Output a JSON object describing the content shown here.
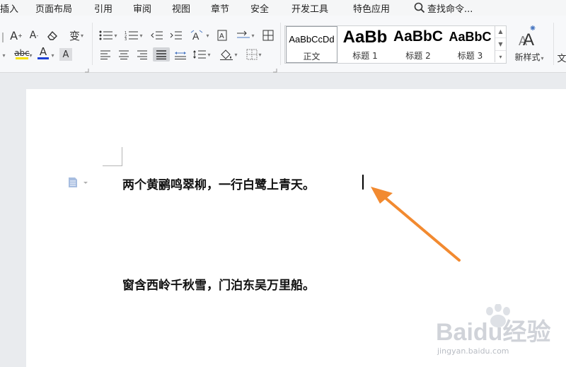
{
  "menu": {
    "items": [
      "插入",
      "页面布局",
      "引用",
      "审阅",
      "视图",
      "章节",
      "安全",
      "开发工具",
      "特色应用"
    ],
    "search_label": "查找命令..."
  },
  "ribbon": {
    "font": {
      "grow_label": "A",
      "shrink_label": "A",
      "pinyin_label": "变",
      "abc_label": "abc",
      "font_color_label": "A",
      "char_shade_label": "A",
      "highlight_color": "#f5e100",
      "font_color": "#e03030"
    },
    "styles": [
      {
        "preview": "AaBbCcDd",
        "label": "正文",
        "active": true
      },
      {
        "preview": "AaBb",
        "label": "标题 1",
        "active": false
      },
      {
        "preview": "AaBbC",
        "label": "标题 2",
        "active": false
      },
      {
        "preview": "AaBbC",
        "label": "标题 3",
        "active": false
      }
    ],
    "new_style_label": "新样式",
    "new_style_caret": "▾",
    "edge_label": "文"
  },
  "document": {
    "line1": "两个黄鹂鸣翠柳，一行白鹭上青天。",
    "line2": "窗含西岭千秋雪，门泊东吴万里船。"
  },
  "annotation": {
    "arrow_color": "#f28a30"
  },
  "watermark": {
    "logo": "Baidu经验",
    "url": "jingyan.baidu.com"
  }
}
